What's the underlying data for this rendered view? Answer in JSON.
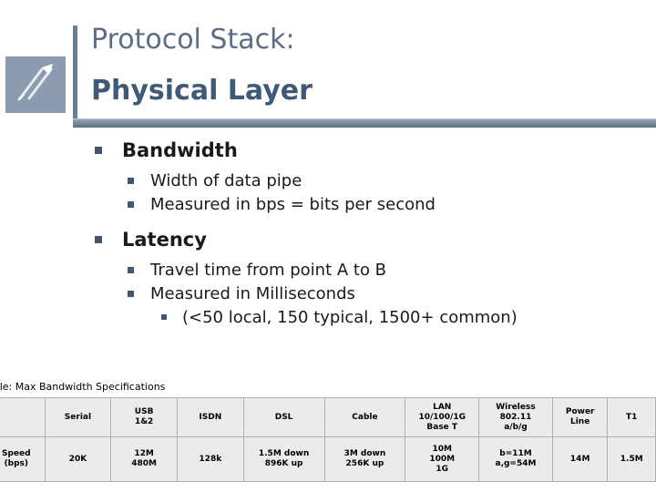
{
  "slide": {
    "title_line1": "Protocol Stack:",
    "title_line2": "Physical Layer",
    "bullets": {
      "bandwidth": "Bandwidth",
      "bandwidth_sub1": "Width of data pipe",
      "bandwidth_sub2": "Measured in bps = bits per second",
      "latency": "Latency",
      "latency_sub1": "Travel time from point A to B",
      "latency_sub2": "Measured in Milliseconds",
      "latency_sub3": "(<50 local, 150 typical, 1500+ common)"
    }
  },
  "table": {
    "caption": "able: Max Bandwidth Specifications",
    "row_label_line1": "Speed",
    "row_label_line2": "(bps)",
    "columns": [
      {
        "header_lines": [
          "Serial"
        ],
        "value_lines": [
          "20K"
        ]
      },
      {
        "header_lines": [
          "USB",
          "1&2"
        ],
        "value_lines": [
          "12M",
          "480M"
        ]
      },
      {
        "header_lines": [
          "ISDN"
        ],
        "value_lines": [
          "128k"
        ]
      },
      {
        "header_lines": [
          "DSL"
        ],
        "value_lines": [
          "1.5M down",
          "896K up"
        ]
      },
      {
        "header_lines": [
          "Cable"
        ],
        "value_lines": [
          "3M down",
          "256K up"
        ]
      },
      {
        "header_lines": [
          "LAN",
          "10/100/1G",
          "Base T"
        ],
        "value_lines": [
          "10M",
          "100M",
          "1G"
        ]
      },
      {
        "header_lines": [
          "Wireless",
          "802.11",
          "a/b/g"
        ],
        "value_lines": [
          "b=11M",
          "a,g=54M"
        ]
      },
      {
        "header_lines": [
          "Power",
          "Line"
        ],
        "value_lines": [
          "14M"
        ]
      },
      {
        "header_lines": [
          "T1"
        ],
        "value_lines": [
          "1.5M"
        ]
      }
    ]
  },
  "colors": {
    "title_top": "#5b6e86",
    "title_bottom": "#3f5a77",
    "bullet": "#44566b",
    "logo_bg": "#8c9bb0",
    "rule": "#7d8da1"
  }
}
